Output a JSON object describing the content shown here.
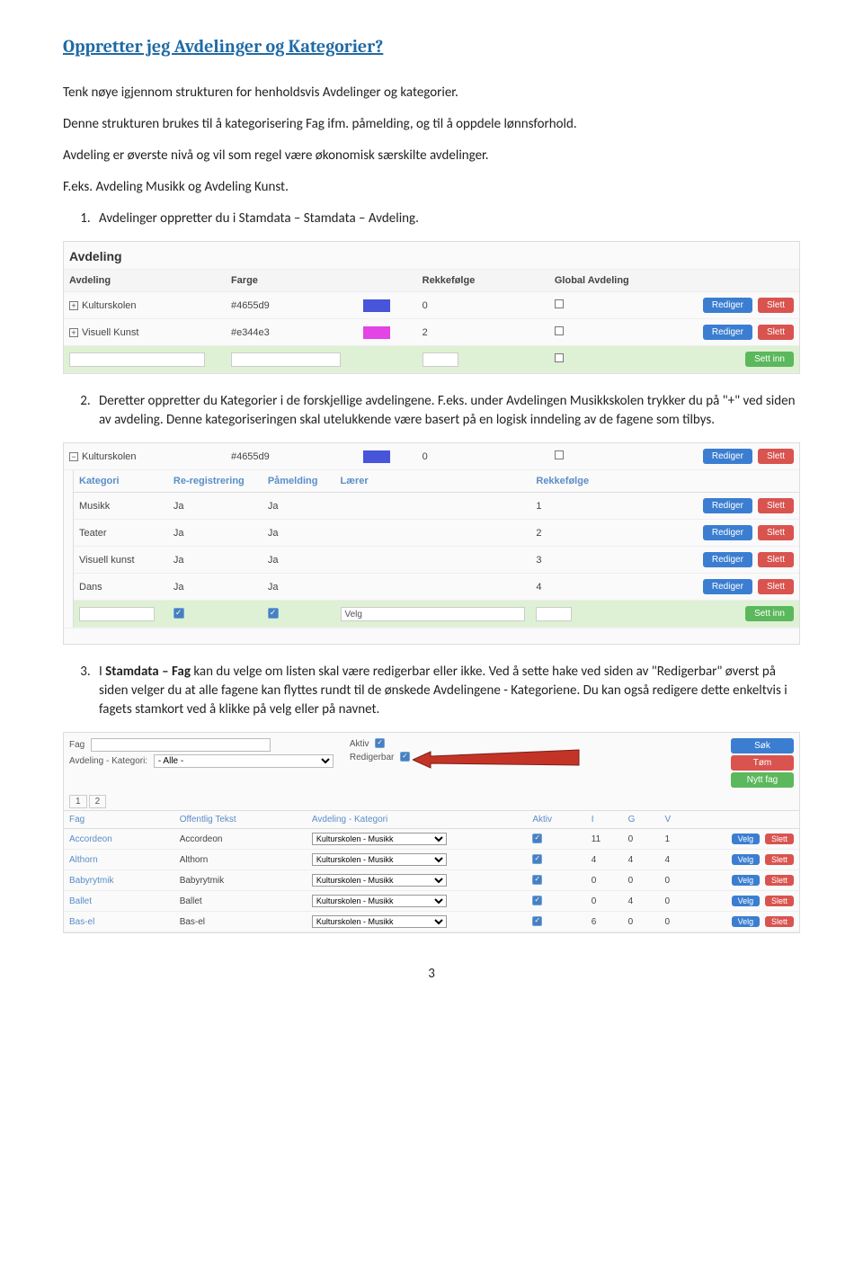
{
  "doc": {
    "title": "Oppretter jeg Avdelinger og Kategorier?",
    "p1": "Tenk nøye igjennom strukturen for henholdsvis Avdelinger og kategorier.",
    "p2": "Denne strukturen brukes til å kategorisering Fag ifm. påmelding, og til å oppdele lønnsforhold.",
    "p3": "Avdeling er øverste nivå og vil som regel være økonomisk særskilte avdelinger.",
    "p4": "F.eks. Avdeling Musikk og Avdeling Kunst.",
    "li1": "Avdelinger oppretter du i Stamdata – Stamdata – Avdeling.",
    "li2a": "Deretter oppretter du Kategorier i de forskjellige avdelingene. F.eks. under Avdelingen Musikkskolen trykker du på \"+\" ved siden av avdeling. Denne kategoriseringen skal utelukkende være basert på en logisk inndeling av de fagene som tilbys.",
    "li3_pre": "I ",
    "li3_bold": "Stamdata – Fag",
    "li3_post": " kan du velge om listen skal være redigerbar eller ikke. Ved å sette hake ved siden av \"Redigerbar\" øverst på siden velger du at alle fagene kan flyttes rundt til de ønskede Avdelingene - Kategoriene. Du kan også redigere dette enkeltvis i fagets stamkort ved å klikke på velg eller på navnet.",
    "page_number": "3"
  },
  "shot1": {
    "heading": "Avdeling",
    "cols": {
      "c1": "Avdeling",
      "c2": "Farge",
      "c3": "",
      "c4": "Rekkefølge",
      "c5": "Global Avdeling",
      "c6": ""
    },
    "rows": [
      {
        "name": "Kulturskolen",
        "hex": "#4655d9",
        "swatch": "#4655d9",
        "order": "0"
      },
      {
        "name": "Visuell Kunst",
        "hex": "#e344e3",
        "swatch": "#e344e3",
        "order": "2"
      }
    ],
    "btn_edit": "Rediger",
    "btn_del": "Slett",
    "btn_insert": "Sett inn"
  },
  "shot2": {
    "toprow": {
      "name": "Kulturskolen",
      "hex": "#4655d9",
      "swatch": "#4655d9",
      "order": "0"
    },
    "cols": {
      "c1": "Kategori",
      "c2": "Re-registrering",
      "c3": "Påmelding",
      "c4": "Lærer",
      "c5": "Rekkefølge",
      "c6": ""
    },
    "rows": [
      {
        "name": "Musikk",
        "re": "Ja",
        "pa": "Ja",
        "order": "1"
      },
      {
        "name": "Teater",
        "re": "Ja",
        "pa": "Ja",
        "order": "2"
      },
      {
        "name": "Visuell kunst",
        "re": "Ja",
        "pa": "Ja",
        "order": "3"
      },
      {
        "name": "Dans",
        "re": "Ja",
        "pa": "Ja",
        "order": "4"
      }
    ],
    "velg": "Velg",
    "btn_edit": "Rediger",
    "btn_del": "Slett",
    "btn_insert": "Sett inn"
  },
  "shot3": {
    "filters": {
      "fag_label": "Fag",
      "avd_label": "Avdeling - Kategori:",
      "avd_value": "- Alle -",
      "aktiv_label": "Aktiv",
      "redig_label": "Redigerbar",
      "btn_sok": "Søk",
      "btn_tom": "Tøm",
      "btn_nytt": "Nytt fag"
    },
    "pager": {
      "p1": "1",
      "p2": "2"
    },
    "cols": {
      "c1": "Fag",
      "c2": "Offentlig Tekst",
      "c3": "Avdeling - Kategori",
      "c4": "Aktiv",
      "c5": "I",
      "c6": "G",
      "c7": "V",
      "c8": ""
    },
    "dd_value": "Kulturskolen - Musikk",
    "rows": [
      {
        "fag": "Accordeon",
        "off": "Accordeon",
        "i": "11",
        "g": "0",
        "v": "1"
      },
      {
        "fag": "Althorn",
        "off": "Althorn",
        "i": "4",
        "g": "4",
        "v": "4"
      },
      {
        "fag": "Babyrytmik",
        "off": "Babyrytmik",
        "i": "0",
        "g": "0",
        "v": "0"
      },
      {
        "fag": "Ballet",
        "off": "Ballet",
        "i": "0",
        "g": "4",
        "v": "0"
      },
      {
        "fag": "Bas-el",
        "off": "Bas-el",
        "i": "6",
        "g": "0",
        "v": "0"
      }
    ],
    "btn_velg": "Velg",
    "btn_del": "Slett"
  }
}
